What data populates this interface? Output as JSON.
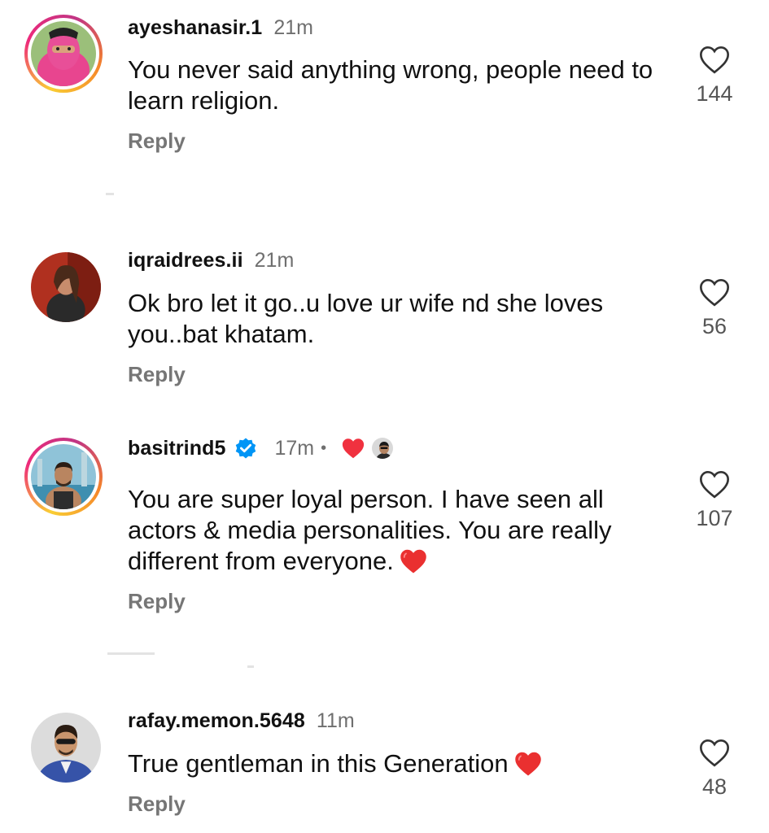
{
  "comments": [
    {
      "username": "ayeshanasir.1",
      "time": "21m",
      "text": "You never said anything wrong, people need to learn religion.",
      "reply": "Reply",
      "likes": "144",
      "has_story": true
    },
    {
      "username": "iqraidrees.ii",
      "time": "21m",
      "text": "Ok bro let it go..u love ur wife nd she loves you..bat khatam.",
      "reply": "Reply",
      "likes": "56",
      "has_story": false
    },
    {
      "username": "basitrind5",
      "time": "17m",
      "dot": "•",
      "verified": true,
      "liked_by_creator": true,
      "text": "You are super loyal person. I have seen all actors & media personalities. You are really different from everyone.",
      "reply": "Reply",
      "likes": "107",
      "has_story": true
    },
    {
      "username": "rafay.memon.5648",
      "time": "11m",
      "text": "True gentleman in this Generation",
      "reply": "Reply",
      "likes": "48",
      "has_story": false
    }
  ],
  "colors": {
    "heart_red": "#f0313f",
    "verified_blue": "#0095f6",
    "secondary_text": "#6f6f6f"
  },
  "icons": [
    "heart-outline-icon",
    "verified-badge-icon",
    "red-heart-icon"
  ]
}
